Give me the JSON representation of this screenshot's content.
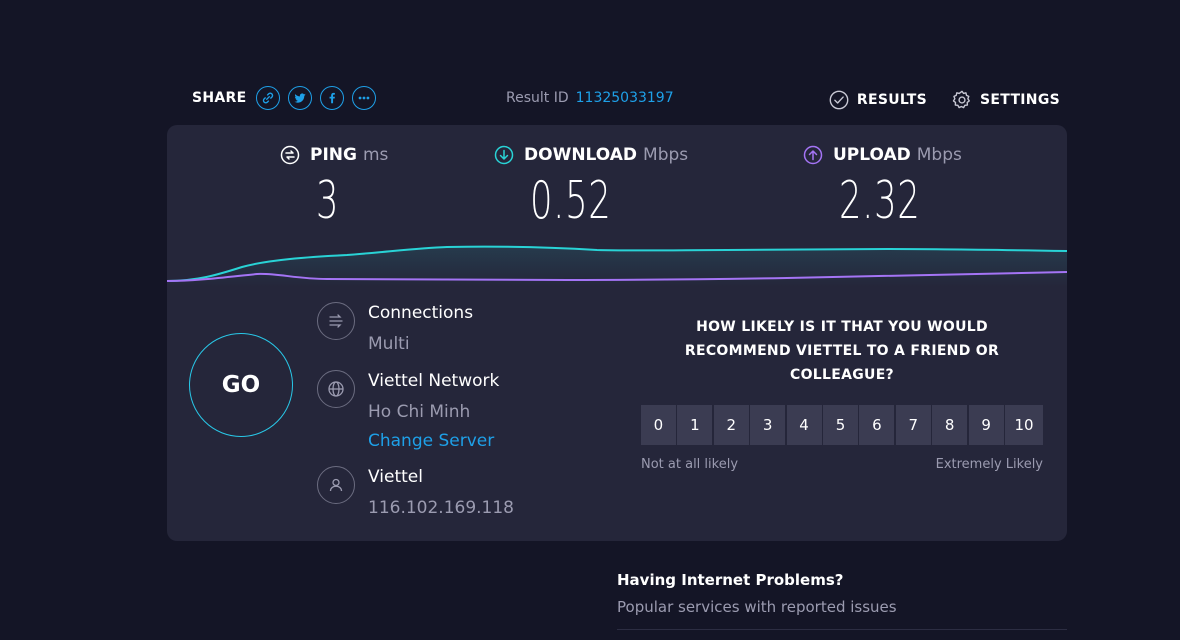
{
  "share": {
    "label": "SHARE",
    "icons": [
      "link-icon",
      "twitter-icon",
      "facebook-icon",
      "more-icon"
    ]
  },
  "result": {
    "label": "Result ID",
    "id": "11325033197"
  },
  "nav": {
    "results": "RESULTS",
    "settings": "SETTINGS"
  },
  "metrics": {
    "ping": {
      "label": "PING",
      "unit": "ms",
      "value": "3"
    },
    "download": {
      "label": "DOWNLOAD",
      "unit": "Mbps",
      "value": "0.52"
    },
    "upload": {
      "label": "UPLOAD",
      "unit": "Mbps",
      "value": "2.32"
    }
  },
  "colors": {
    "download": "#29d3d6",
    "upload": "#a474f5",
    "link": "#1ea0e8",
    "background": "#141526",
    "panel": "#25263a"
  },
  "go": {
    "label": "GO"
  },
  "connections": {
    "title": "Connections",
    "value": "Multi"
  },
  "server": {
    "title": "Viettel Network",
    "location": "Ho Chi Minh",
    "change": "Change Server"
  },
  "isp": {
    "title": "Viettel",
    "ip": "116.102.169.118"
  },
  "survey": {
    "question": "HOW LIKELY IS IT THAT YOU WOULD RECOMMEND VIETTEL TO A FRIEND OR COLLEAGUE?",
    "scale": [
      "0",
      "1",
      "2",
      "3",
      "4",
      "5",
      "6",
      "7",
      "8",
      "9",
      "10"
    ],
    "low_label": "Not at all likely",
    "high_label": "Extremely Likely"
  },
  "problems": {
    "title": "Having Internet Problems?",
    "subtitle": "Popular services with reported issues"
  }
}
